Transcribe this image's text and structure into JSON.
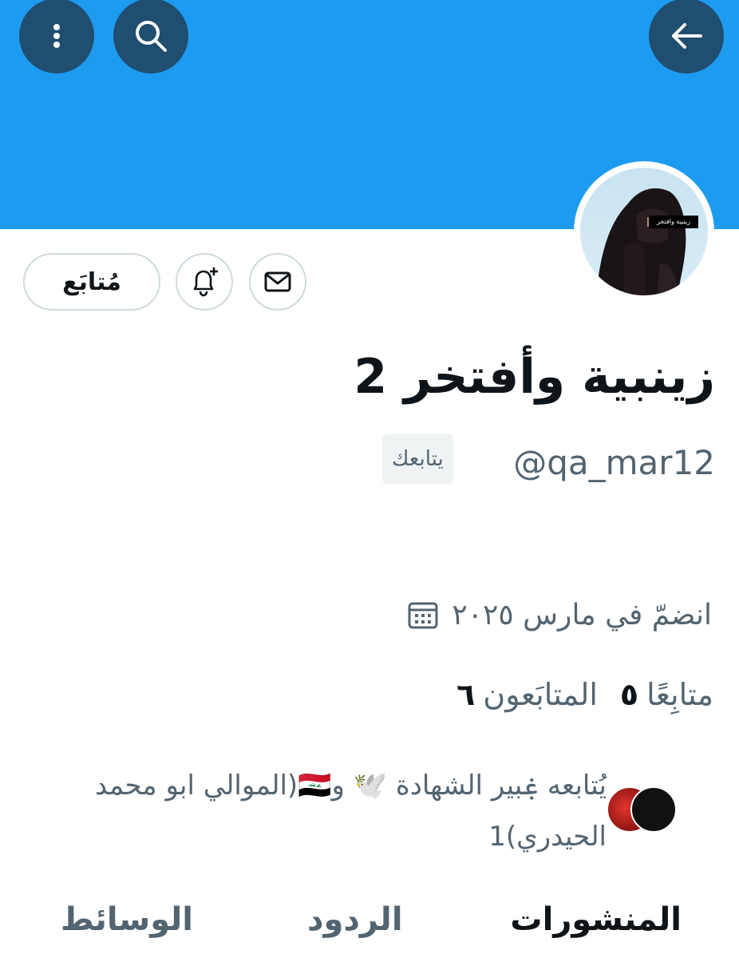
{
  "header": {
    "back_icon": "arrow-left-icon",
    "search_icon": "search-icon",
    "more_icon": "more-vertical-icon",
    "banner_color": "#1d9bf0"
  },
  "profile": {
    "avatar_tag": "زينبية وافتخر",
    "display_name": "زينبية وأفتخر 2",
    "handle": "@qa_mar12",
    "follows_you": "يتابعك",
    "joined": "انضمّ في مارس ٢٠٢٥",
    "following_count": "٥",
    "following_label": "متابِعًا",
    "followers_count": "٦",
    "followers_label": "المتابَعون",
    "followed_by": "يُتابعه ۼبير الشهادة 🕊️ و🇮🇶(الموالي ابو محمد الحيدري)1"
  },
  "actions": {
    "message_icon": "mail-icon",
    "notify_icon": "bell-plus-icon",
    "follow_label": "مُتابَع"
  },
  "tabs": [
    {
      "label": "المنشورات",
      "active": true
    },
    {
      "label": "الردود",
      "active": false
    },
    {
      "label": "الوسائط",
      "active": false
    }
  ]
}
